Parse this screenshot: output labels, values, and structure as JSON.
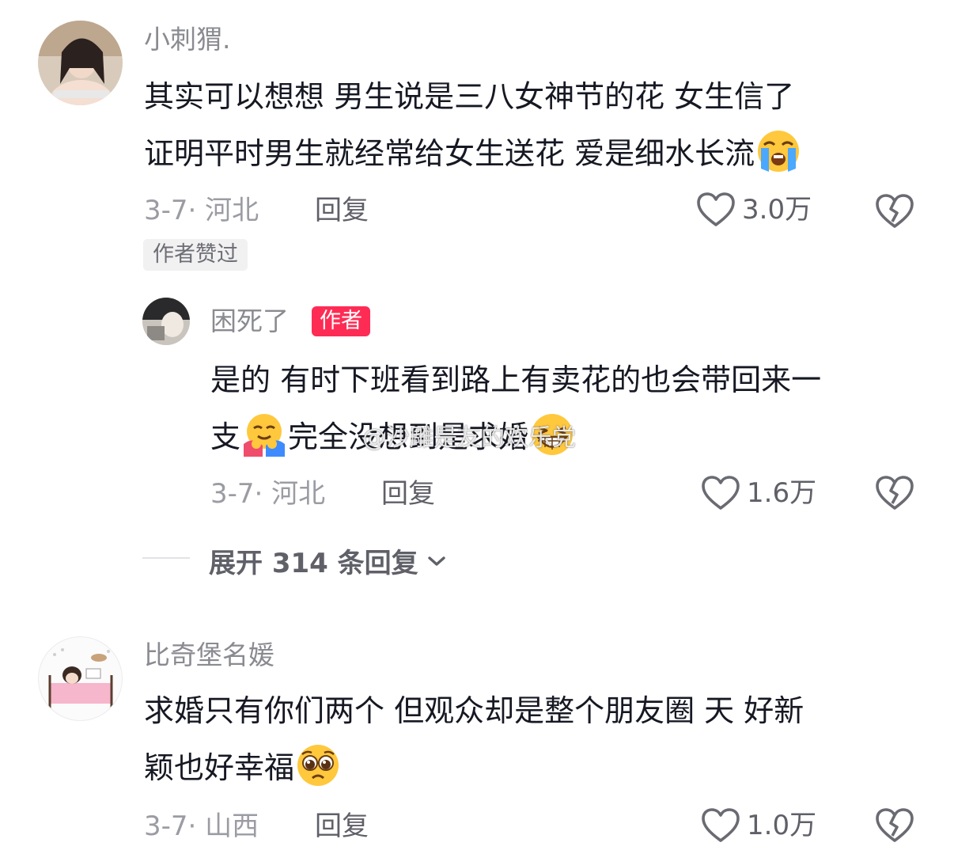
{
  "comments": [
    {
      "username": "小刺猬.",
      "content_line1": "其实可以想想 男生说是三八女神节的花 女生信了",
      "content_line2": "证明平时男生就经常给女生送花 爱是细水长流",
      "emoji": "loudly-crying-face",
      "date_location": "3-7· 河北",
      "reply_label": "回复",
      "likes": "3.0万",
      "badge": "作者赞过",
      "reply": {
        "username": "困死了",
        "author_tag": "作者",
        "content_line1": "是的 有时下班看到路上有卖花的也会带回来一",
        "content_line2_a": "支",
        "content_line2_b": "完全没想到是求婚",
        "emoji_a": "hugging-face",
        "emoji_b": "grinning-squinting-face",
        "date_location": "3-7· 河北",
        "reply_label": "回复",
        "likes": "1.6万"
      },
      "expand_label": "展开 314 条回复"
    },
    {
      "username": "比奇堡名媛",
      "content_line1": "求婚只有你们两个 但观众却是整个朋友圈 天 好新",
      "content_line2": "颖也好幸福",
      "emoji": "pleading-face",
      "date_location": "3-7· 山西",
      "reply_label": "回复",
      "likes": "1.0万"
    }
  ],
  "watermark": "@沙雕是友的欢乐党",
  "icons": {
    "like": "heart-outline-icon",
    "dislike": "broken-heart-icon",
    "expand": "chevron-down-icon"
  },
  "colors": {
    "author_tag": "#fe2c55",
    "secondary_text": "#8a8b91"
  }
}
